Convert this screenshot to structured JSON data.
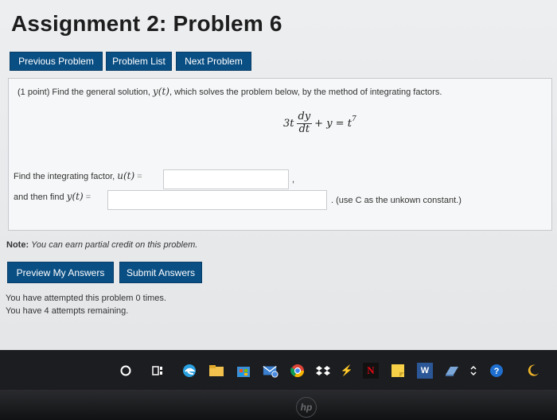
{
  "page": {
    "title": "Assignment 2: Problem 6"
  },
  "nav": {
    "previous_label": "Previous Problem",
    "list_label": "Problem List",
    "next_label": "Next Problem"
  },
  "problem": {
    "intro_prefix": "(1 point) Find the general solution,",
    "intro_y": "y(t)",
    "intro_suffix": ", which solves the problem below, by the method of integrating factors.",
    "eq_coef": "3t",
    "eq_num": "dy",
    "eq_den": "dt",
    "eq_rest": "+ y = t",
    "eq_exp": "7",
    "factor_label": "Find the integrating factor,",
    "factor_var": "u(t)",
    "factor_eq": "=",
    "factor_value": "",
    "factor_after": ",",
    "solution_label": "and then find",
    "solution_var": "y(t)",
    "solution_eq": "=",
    "solution_value": "",
    "solution_hint": ". (use C as the unkown constant.)"
  },
  "note": {
    "bold": "Note:",
    "text": "You can earn partial credit on this problem."
  },
  "actions": {
    "preview_label": "Preview My Answers",
    "submit_label": "Submit Answers"
  },
  "attempts": {
    "line1": "You have attempted this problem 0 times.",
    "line2": "You have 4 attempts remaining."
  },
  "taskbar": {
    "icons": [
      "search-icon",
      "task-view-icon",
      "edge-icon",
      "file-explorer-icon",
      "store-icon",
      "mail-icon",
      "chrome-icon",
      "dropbox-icon",
      "bolt-icon",
      "netflix-icon",
      "sticky-notes-icon",
      "word-icon",
      "app-icon",
      "chevron-icon",
      "help-icon",
      "moon-icon"
    ],
    "netflix_glyph": "N",
    "word_glyph": "W",
    "bolt_glyph": "⚡"
  },
  "bezel": {
    "logo": "hp"
  }
}
